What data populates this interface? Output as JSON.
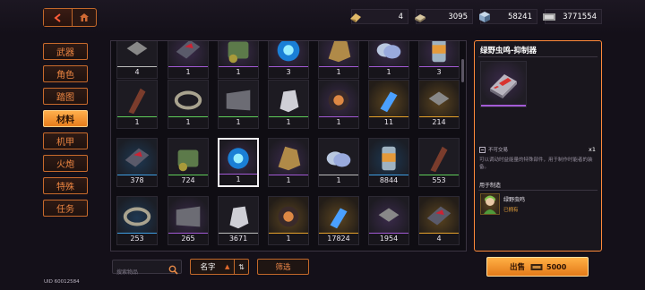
{
  "nav": {
    "back_icon": "chevron-left-icon",
    "home_icon": "home-icon"
  },
  "currencies": [
    {
      "icon": "gold-ingot-icon",
      "value": "4"
    },
    {
      "icon": "credit-stack-icon",
      "value": "3095"
    },
    {
      "icon": "blue-crystal-cube-icon",
      "value": "58241"
    },
    {
      "icon": "banknote-icon",
      "value": "3771554"
    }
  ],
  "side_menu": [
    {
      "label": "武器",
      "active": false
    },
    {
      "label": "角色",
      "active": false
    },
    {
      "label": "踏图",
      "active": false
    },
    {
      "label": "材料",
      "active": true
    },
    {
      "label": "机甲",
      "active": false
    },
    {
      "label": "火炮",
      "active": false
    },
    {
      "label": "特殊",
      "active": false
    },
    {
      "label": "任务",
      "active": false
    }
  ],
  "rows": [
    [
      {
        "q": "4",
        "r": "white"
      },
      {
        "q": "1",
        "r": "purple"
      },
      {
        "q": "1",
        "r": "purple"
      },
      {
        "q": "3",
        "r": "purple"
      },
      {
        "q": "1",
        "r": "purple"
      },
      {
        "q": "1",
        "r": "purple"
      },
      {
        "q": "3",
        "r": "purple"
      }
    ],
    [
      {
        "q": "1",
        "r": "green"
      },
      {
        "q": "1",
        "r": "green"
      },
      {
        "q": "1",
        "r": "green"
      },
      {
        "q": "1",
        "r": "green"
      },
      {
        "q": "1",
        "r": "purple"
      },
      {
        "q": "11",
        "r": "gold"
      },
      {
        "q": "214",
        "r": "gold"
      }
    ],
    [
      {
        "q": "378",
        "r": "blue"
      },
      {
        "q": "724",
        "r": "green"
      },
      {
        "q": "1",
        "r": "purple"
      },
      {
        "q": "1",
        "r": "purple"
      },
      {
        "q": "1",
        "r": "white"
      },
      {
        "q": "8844",
        "r": "blue"
      },
      {
        "q": "553",
        "r": "green"
      }
    ],
    [
      {
        "q": "253",
        "r": "blue"
      },
      {
        "q": "265",
        "r": "purple"
      },
      {
        "q": "3671",
        "r": "white"
      },
      {
        "q": "1",
        "r": "gold"
      },
      {
        "q": "17824",
        "r": "gold"
      },
      {
        "q": "1954",
        "r": "purple"
      },
      {
        "q": "4",
        "r": "gold"
      }
    ]
  ],
  "search": {
    "placeholder": "搜索物品"
  },
  "sort": {
    "label": "名字",
    "direction_icon": "triangle-up-icon",
    "toggle_icon": "swap-vertical-icon"
  },
  "filter": {
    "label": "筛选"
  },
  "uid": "UID 60012584",
  "detail": {
    "title": "绿野虫鸣-抑制器",
    "trade_note": "不可交易",
    "count": "x1",
    "description": "可以调动时益能量的特殊部件，用于制作时能者的装备。",
    "used_for_title": "用于制造",
    "used_item_name": "绿野虫鸣",
    "used_item_status": "已拥有"
  },
  "sell": {
    "label": "出售",
    "amount": "5000"
  },
  "colors": {
    "accent": "#ff8a3a",
    "active_tab": "#f39a36",
    "rarity_purple": "#a35ad6",
    "rarity_gold": "#e7a32b",
    "rarity_blue": "#3f9fe3",
    "rarity_green": "#5fcf5a"
  }
}
